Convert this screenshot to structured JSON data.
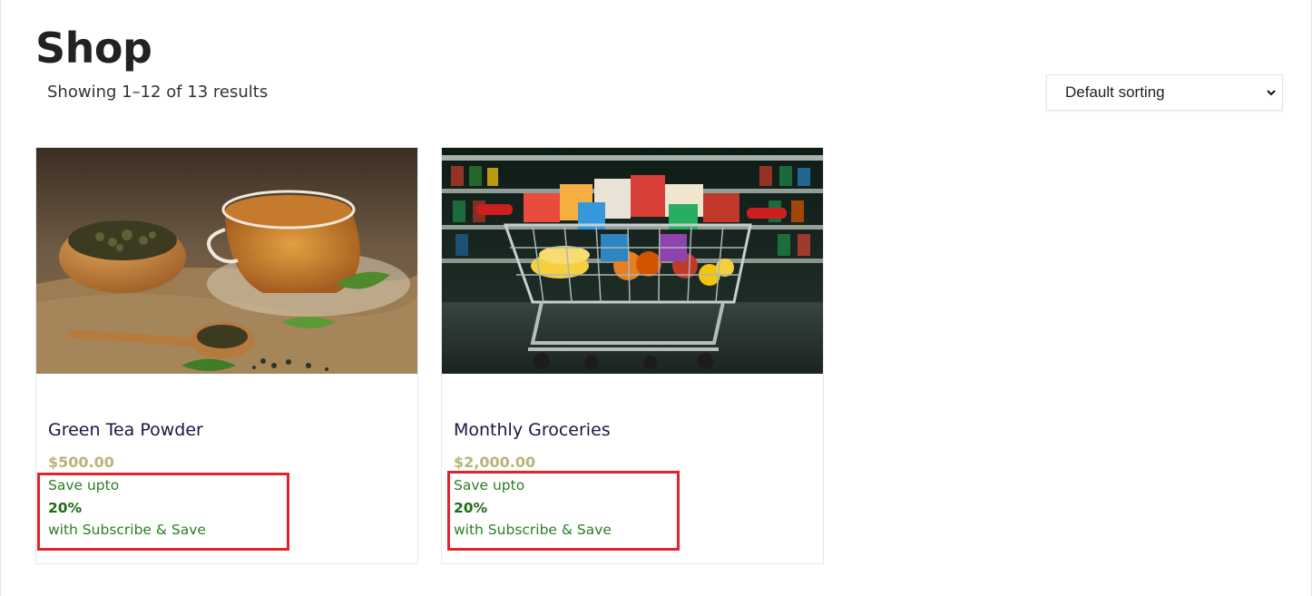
{
  "page": {
    "title": "Shop",
    "result_count": "Showing 1–12 of 13 results"
  },
  "sorting": {
    "selected": "Default sorting"
  },
  "products": [
    {
      "name": "Green Tea Powder",
      "price": "$500.00",
      "image": "green-tea-photo",
      "promo": {
        "line1": "Save upto",
        "percent": "20%",
        "line3": "with Subscribe & Save"
      }
    },
    {
      "name": "Monthly Groceries",
      "price": "$2,000.00",
      "image": "grocery-cart-photo",
      "promo": {
        "line1": "Save upto",
        "percent": "20%",
        "line3": "with Subscribe & Save"
      }
    }
  ],
  "colors": {
    "title": "#1c1642",
    "price": "#b9b37a",
    "promo_text": "#2b7d24",
    "highlight_border": "#e3232b"
  }
}
